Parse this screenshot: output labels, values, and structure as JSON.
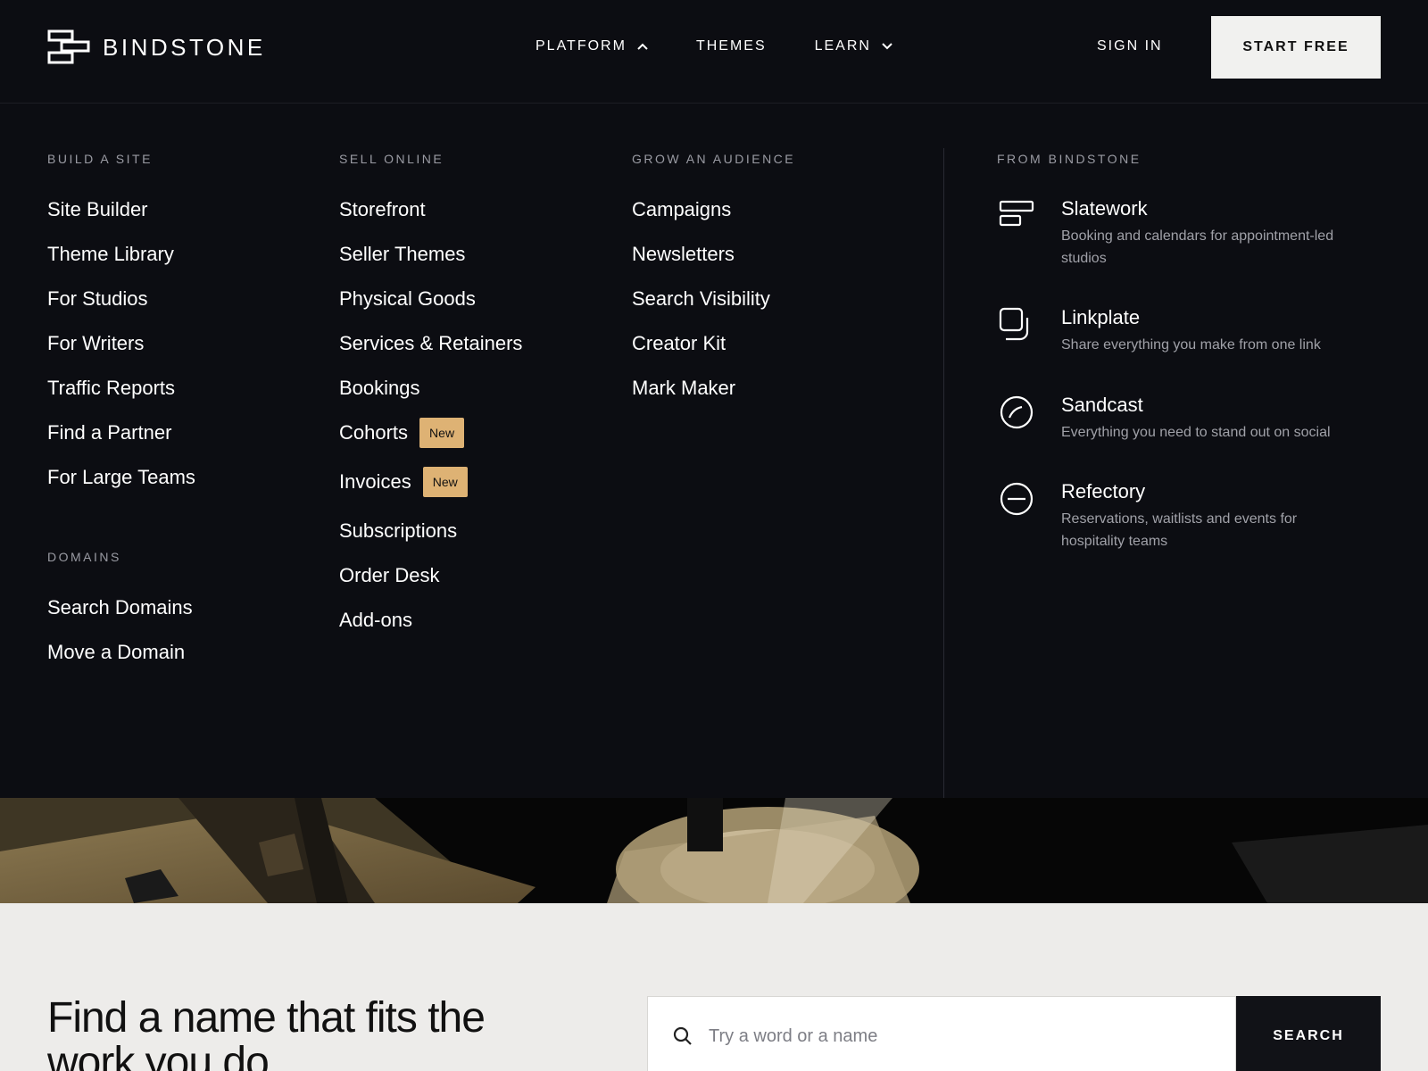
{
  "header": {
    "brand": "BINDSTONE",
    "nav": [
      {
        "label": "PLATFORM",
        "icon": "chevron-up-icon"
      },
      {
        "label": "THEMES"
      },
      {
        "label": "LEARN",
        "icon": "chevron-down-icon"
      }
    ],
    "sign_in": "SIGN IN",
    "start_free": "START FREE"
  },
  "menu": {
    "build": {
      "heading": "BUILD A SITE",
      "items": [
        "Site Builder",
        "Theme Library",
        "For Studios",
        "For Writers",
        "Traffic Reports",
        "Find a Partner",
        "For Large Teams"
      ]
    },
    "domains": {
      "heading": "DOMAINS",
      "items": [
        "Search Domains",
        "Move a Domain"
      ]
    },
    "sell": {
      "heading": "SELL ONLINE",
      "items": [
        {
          "label": "Storefront"
        },
        {
          "label": "Seller Themes"
        },
        {
          "label": "Physical Goods"
        },
        {
          "label": "Services & Retainers"
        },
        {
          "label": "Bookings"
        },
        {
          "label": "Cohorts",
          "badge": "New"
        },
        {
          "label": "Invoices",
          "badge": "New"
        },
        {
          "label": "Subscriptions"
        },
        {
          "label": "Order Desk"
        },
        {
          "label": "Add-ons"
        }
      ]
    },
    "grow": {
      "heading": "GROW AN AUDIENCE",
      "items": [
        "Campaigns",
        "Newsletters",
        "Search Visibility",
        "Creator Kit",
        "Mark Maker"
      ]
    },
    "from": {
      "heading": "FROM BINDSTONE",
      "products": [
        {
          "name": "Slatework",
          "desc": "Booking and calendars for appointment-led studios",
          "icon": "calendar-blocks-icon"
        },
        {
          "name": "Linkplate",
          "desc": "Share everything you make from one link",
          "icon": "stacked-squares-icon"
        },
        {
          "name": "Sandcast",
          "desc": "Everything you need to stand out on social",
          "icon": "circle-swoosh-icon"
        },
        {
          "name": "Refectory",
          "desc": "Reservations, waitlists and events for hospitality teams",
          "icon": "circle-minus-icon"
        }
      ]
    }
  },
  "search": {
    "headline": "Find a name that fits the work you do",
    "placeholder": "Try a word or a name",
    "button": "SEARCH"
  },
  "colors": {
    "background": "#0c0d12",
    "badge": "#deb274",
    "bottom": "#edecea"
  }
}
